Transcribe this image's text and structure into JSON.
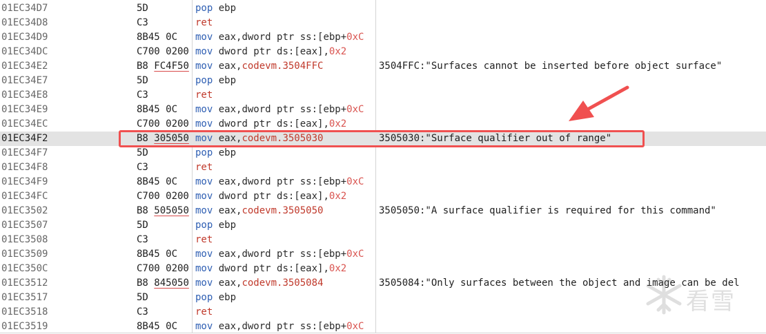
{
  "rows": [
    {
      "addr": "01EC34D7",
      "bytes": [
        {
          "t": "5D"
        }
      ],
      "instr": [
        {
          "t": "pop",
          "k": "mnem"
        },
        {
          "t": " "
        },
        {
          "t": "ebp",
          "k": "reg"
        }
      ],
      "comment": ""
    },
    {
      "addr": "01EC34D8",
      "bytes": [
        {
          "t": "C3"
        }
      ],
      "instr": [
        {
          "t": "ret",
          "k": "label"
        }
      ],
      "comment": ""
    },
    {
      "addr": "01EC34D9",
      "bytes": [
        {
          "t": "8B45 0C"
        }
      ],
      "instr": [
        {
          "t": "mov",
          "k": "mnem"
        },
        {
          "t": " eax,dword ptr "
        },
        {
          "t": "ss",
          "k": "seg"
        },
        {
          "t": ":[ebp+"
        },
        {
          "t": "0xC",
          "k": "num"
        }
      ],
      "comment": ""
    },
    {
      "addr": "01EC34DC",
      "bytes": [
        {
          "t": "C700 0200"
        }
      ],
      "instr": [
        {
          "t": "mov",
          "k": "mnem"
        },
        {
          "t": " dword ptr "
        },
        {
          "t": "ds",
          "k": "seg"
        },
        {
          "t": ":[eax],"
        },
        {
          "t": "0x2",
          "k": "num"
        }
      ],
      "comment": ""
    },
    {
      "addr": "01EC34E2",
      "bytes": [
        {
          "t": "B8 "
        },
        {
          "t": "FC4F50",
          "u": true
        }
      ],
      "instr": [
        {
          "t": "mov",
          "k": "mnem"
        },
        {
          "t": " eax,"
        },
        {
          "t": "codevm.3504FFC",
          "k": "label"
        }
      ],
      "comment": "3504FFC:\"Surfaces cannot be inserted before object surface\""
    },
    {
      "addr": "01EC34E7",
      "bytes": [
        {
          "t": "5D"
        }
      ],
      "instr": [
        {
          "t": "pop",
          "k": "mnem"
        },
        {
          "t": " "
        },
        {
          "t": "ebp",
          "k": "reg"
        }
      ],
      "comment": ""
    },
    {
      "addr": "01EC34E8",
      "bytes": [
        {
          "t": "C3"
        }
      ],
      "instr": [
        {
          "t": "ret",
          "k": "label"
        }
      ],
      "comment": ""
    },
    {
      "addr": "01EC34E9",
      "bytes": [
        {
          "t": "8B45 0C"
        }
      ],
      "instr": [
        {
          "t": "mov",
          "k": "mnem"
        },
        {
          "t": " eax,dword ptr "
        },
        {
          "t": "ss",
          "k": "seg"
        },
        {
          "t": ":[ebp+"
        },
        {
          "t": "0xC",
          "k": "num"
        }
      ],
      "comment": ""
    },
    {
      "addr": "01EC34EC",
      "bytes": [
        {
          "t": "C700 0200"
        }
      ],
      "instr": [
        {
          "t": "mov",
          "k": "mnem"
        },
        {
          "t": " dword ptr "
        },
        {
          "t": "ds",
          "k": "seg"
        },
        {
          "t": ":[eax],"
        },
        {
          "t": "0x2",
          "k": "num"
        }
      ],
      "comment": ""
    },
    {
      "addr": "01EC34F2",
      "selected": true,
      "bytes": [
        {
          "t": "B8 "
        },
        {
          "t": "305050",
          "u": true
        }
      ],
      "instr": [
        {
          "t": "mov",
          "k": "mnem"
        },
        {
          "t": " eax,"
        },
        {
          "t": "codevm.3505030",
          "k": "label"
        }
      ],
      "comment": "3505030:\"Surface qualifier out of range\""
    },
    {
      "addr": "01EC34F7",
      "bytes": [
        {
          "t": "5D"
        }
      ],
      "instr": [
        {
          "t": "pop",
          "k": "mnem"
        },
        {
          "t": " "
        },
        {
          "t": "ebp",
          "k": "reg"
        }
      ],
      "comment": ""
    },
    {
      "addr": "01EC34F8",
      "bytes": [
        {
          "t": "C3"
        }
      ],
      "instr": [
        {
          "t": "ret",
          "k": "label"
        }
      ],
      "comment": ""
    },
    {
      "addr": "01EC34F9",
      "bytes": [
        {
          "t": "8B45 0C"
        }
      ],
      "instr": [
        {
          "t": "mov",
          "k": "mnem"
        },
        {
          "t": " eax,dword ptr "
        },
        {
          "t": "ss",
          "k": "seg"
        },
        {
          "t": ":[ebp+"
        },
        {
          "t": "0xC",
          "k": "num"
        }
      ],
      "comment": ""
    },
    {
      "addr": "01EC34FC",
      "bytes": [
        {
          "t": "C700 0200"
        }
      ],
      "instr": [
        {
          "t": "mov",
          "k": "mnem"
        },
        {
          "t": " dword ptr "
        },
        {
          "t": "ds",
          "k": "seg"
        },
        {
          "t": ":[eax],"
        },
        {
          "t": "0x2",
          "k": "num"
        }
      ],
      "comment": ""
    },
    {
      "addr": "01EC3502",
      "bytes": [
        {
          "t": "B8 "
        },
        {
          "t": "505050",
          "u": true
        }
      ],
      "instr": [
        {
          "t": "mov",
          "k": "mnem"
        },
        {
          "t": " eax,"
        },
        {
          "t": "codevm.3505050",
          "k": "label"
        }
      ],
      "comment": "3505050:\"A surface qualifier is required for this command\""
    },
    {
      "addr": "01EC3507",
      "bytes": [
        {
          "t": "5D"
        }
      ],
      "instr": [
        {
          "t": "pop",
          "k": "mnem"
        },
        {
          "t": " "
        },
        {
          "t": "ebp",
          "k": "reg"
        }
      ],
      "comment": ""
    },
    {
      "addr": "01EC3508",
      "bytes": [
        {
          "t": "C3"
        }
      ],
      "instr": [
        {
          "t": "ret",
          "k": "label"
        }
      ],
      "comment": ""
    },
    {
      "addr": "01EC3509",
      "bytes": [
        {
          "t": "8B45 0C"
        }
      ],
      "instr": [
        {
          "t": "mov",
          "k": "mnem"
        },
        {
          "t": " eax,dword ptr "
        },
        {
          "t": "ss",
          "k": "seg"
        },
        {
          "t": ":[ebp+"
        },
        {
          "t": "0xC",
          "k": "num"
        }
      ],
      "comment": ""
    },
    {
      "addr": "01EC350C",
      "bytes": [
        {
          "t": "C700 0200"
        }
      ],
      "instr": [
        {
          "t": "mov",
          "k": "mnem"
        },
        {
          "t": " dword ptr "
        },
        {
          "t": "ds",
          "k": "seg"
        },
        {
          "t": ":[eax],"
        },
        {
          "t": "0x2",
          "k": "num"
        }
      ],
      "comment": ""
    },
    {
      "addr": "01EC3512",
      "bytes": [
        {
          "t": "B8 "
        },
        {
          "t": "845050",
          "u": true
        }
      ],
      "instr": [
        {
          "t": "mov",
          "k": "mnem"
        },
        {
          "t": " eax,"
        },
        {
          "t": "codevm.3505084",
          "k": "label"
        }
      ],
      "comment": "3505084:\"Only surfaces between the object and image can be del"
    },
    {
      "addr": "01EC3517",
      "bytes": [
        {
          "t": "5D"
        }
      ],
      "instr": [
        {
          "t": "pop",
          "k": "mnem"
        },
        {
          "t": " "
        },
        {
          "t": "ebp",
          "k": "reg"
        }
      ],
      "comment": ""
    },
    {
      "addr": "01EC3518",
      "bytes": [
        {
          "t": "C3"
        }
      ],
      "instr": [
        {
          "t": "ret",
          "k": "label"
        }
      ],
      "comment": ""
    },
    {
      "addr": "01EC3519",
      "bytes": [
        {
          "t": "8B45 0C"
        }
      ],
      "instr": [
        {
          "t": "mov",
          "k": "mnem"
        },
        {
          "t": " eax,dword ptr "
        },
        {
          "t": "ss",
          "k": "seg"
        },
        {
          "t": ":[ebp+"
        },
        {
          "t": "0xC",
          "k": "num"
        }
      ],
      "comment": ""
    }
  ],
  "annotation": {
    "box_color": "#f05050",
    "arrow_color": "#f05050"
  },
  "watermark": {
    "text": "看雪",
    "icon": "snowflake-icon"
  }
}
